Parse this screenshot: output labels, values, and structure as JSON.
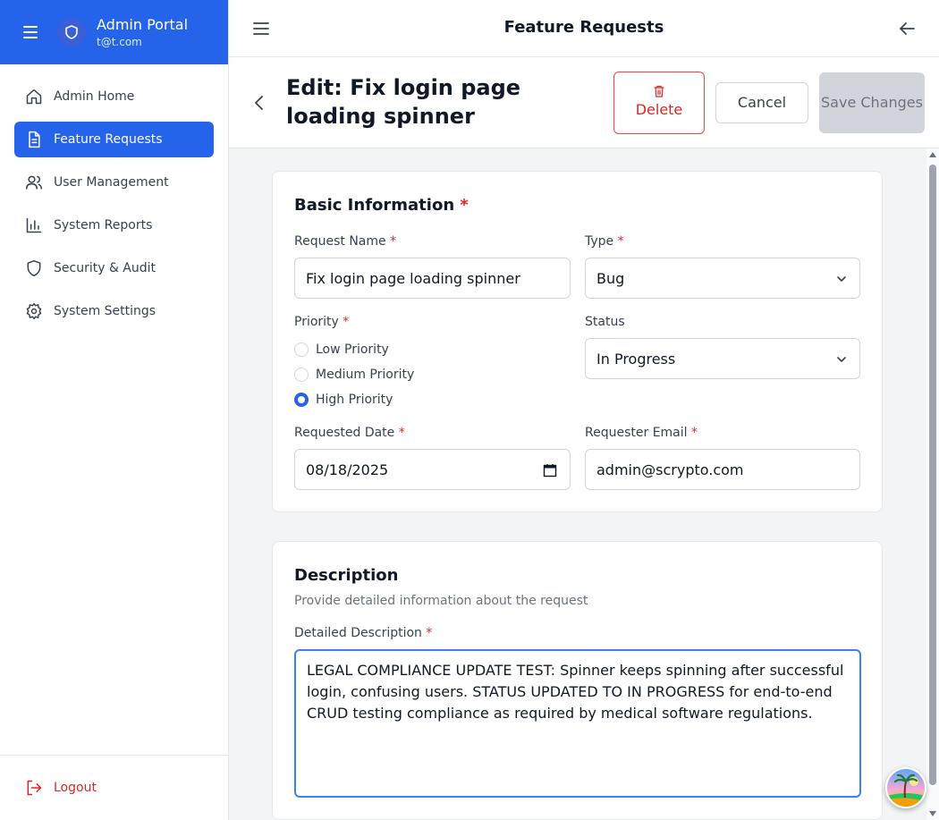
{
  "app": {
    "title": "Admin Portal",
    "email": "t@t.com"
  },
  "sidebar": {
    "items": [
      {
        "label": "Admin Home",
        "icon": "home-icon"
      },
      {
        "label": "Feature Requests",
        "icon": "document-icon",
        "active": true
      },
      {
        "label": "User Management",
        "icon": "users-icon"
      },
      {
        "label": "System Reports",
        "icon": "bar-chart-icon"
      },
      {
        "label": "Security & Audit",
        "icon": "shield-icon"
      },
      {
        "label": "System Settings",
        "icon": "gear-icon"
      }
    ],
    "logout_label": "Logout"
  },
  "topbar": {
    "title": "Feature Requests"
  },
  "header": {
    "title": "Edit: Fix login page loading spinner",
    "delete_label": "Delete",
    "cancel_label": "Cancel",
    "save_label": "Save Changes"
  },
  "basic": {
    "title": "Basic Information",
    "request_name": {
      "label": "Request Name",
      "value": "Fix login page loading spinner"
    },
    "type": {
      "label": "Type",
      "value": "Bug"
    },
    "priority": {
      "label": "Priority",
      "options": [
        "Low Priority",
        "Medium Priority",
        "High Priority"
      ],
      "selected": "High Priority"
    },
    "status": {
      "label": "Status",
      "value": "In Progress"
    },
    "requested_date": {
      "label": "Requested Date",
      "value": "08/18/2025"
    },
    "requester_email": {
      "label": "Requester Email",
      "value": "admin@scrypto.com"
    }
  },
  "description": {
    "title": "Description",
    "subtitle": "Provide detailed information about the request",
    "field_label": "Detailed Description",
    "value": "LEGAL COMPLIANCE UPDATE TEST: Spinner keeps spinning after successful login, confusing users. STATUS UPDATED TO IN PROGRESS for end-to-end CRUD testing compliance as required by medical software regulations."
  },
  "colors": {
    "primary": "#2563eb",
    "danger": "#dc2626",
    "required": "#dc2626"
  }
}
